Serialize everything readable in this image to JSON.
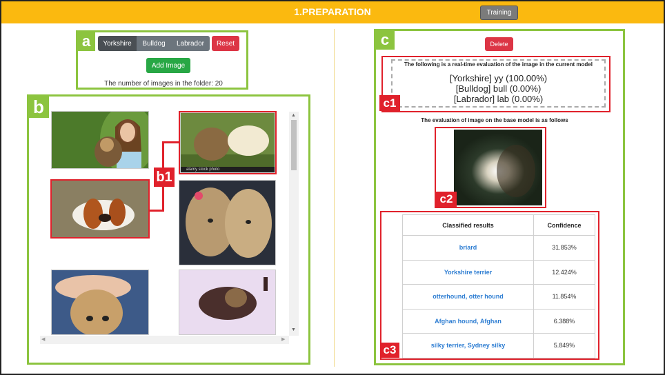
{
  "header": {
    "title": "1.PREPARATION",
    "training_label": "Training"
  },
  "panel_a": {
    "tag": "a",
    "classes": [
      "Yorkshire",
      "Bulldog",
      "Labrador"
    ],
    "reset_label": "Reset",
    "add_label": "Add Image",
    "count_text": "The number of images in the folder: 20"
  },
  "panel_b": {
    "tag": "b",
    "callout": "b1"
  },
  "panel_c": {
    "tag": "c",
    "delete_label": "Delete",
    "current_heading": "The following is a real-time evaluation of the image in the current model",
    "current_results": [
      "[Yorkshire] yy (100.00%)",
      "[Bulldog] bull (0.00%)",
      "[Labrador] lab (0.00%)"
    ],
    "c1": "c1",
    "base_heading": "The evaluation of image on the base model is as follows",
    "c2": "c2",
    "c3": "c3",
    "table": {
      "headers": [
        "Classified results",
        "Confidence"
      ],
      "rows": [
        {
          "label": "briard",
          "conf": "31.853%"
        },
        {
          "label": "Yorkshire terrier",
          "conf": "12.424%"
        },
        {
          "label": "otterhound, otter hound",
          "conf": "11.854%"
        },
        {
          "label": "Afghan hound, Afghan",
          "conf": "6.388%"
        },
        {
          "label": "silky terrier, Sydney silky",
          "conf": "5.849%"
        }
      ]
    }
  },
  "photos": {
    "stock_caption": "alamy stock photo"
  }
}
